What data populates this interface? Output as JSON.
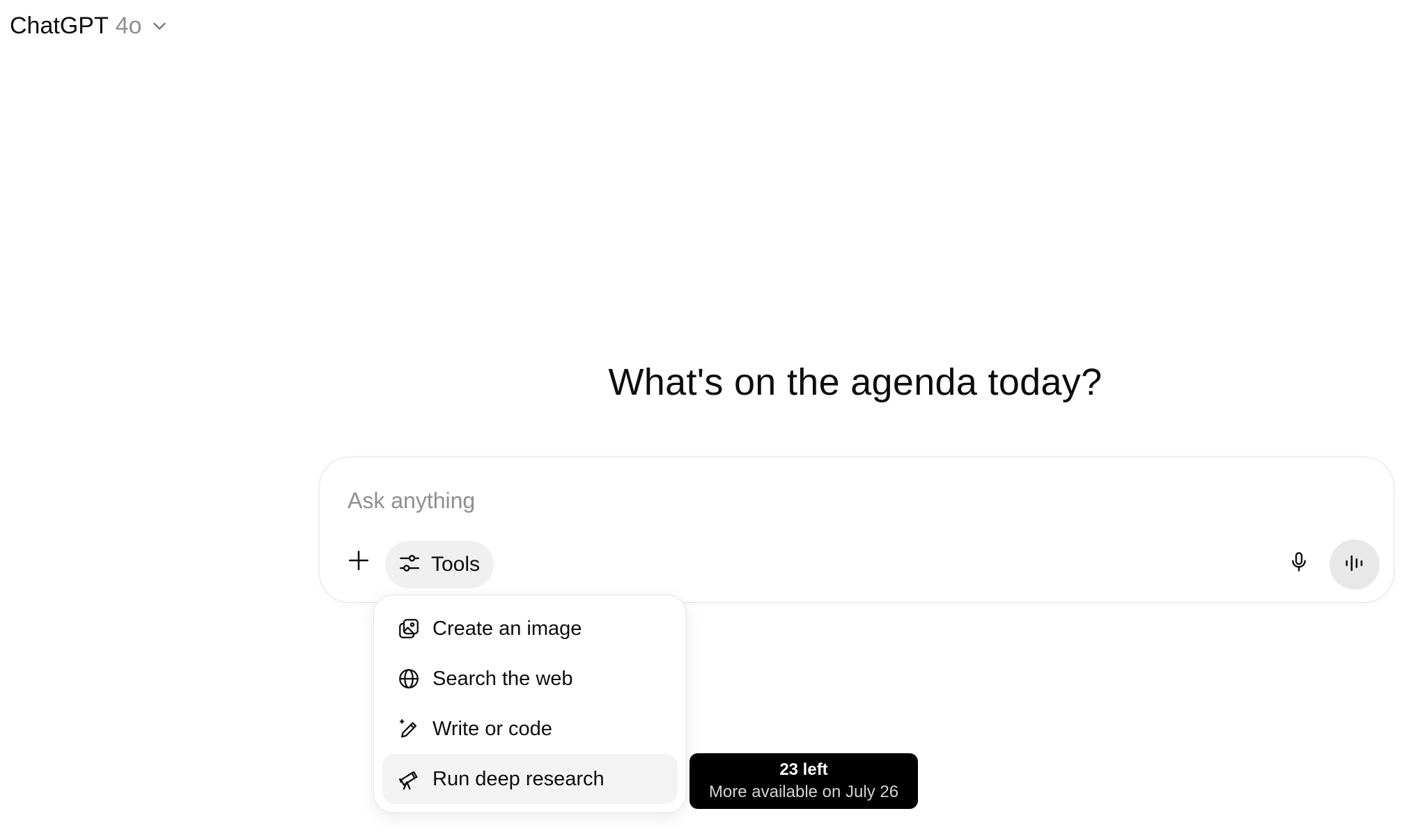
{
  "header": {
    "model_name": "ChatGPT",
    "model_version": "4o",
    "dropdown_icon": "chevron-down-icon"
  },
  "main": {
    "headline": "What's on the agenda today?"
  },
  "composer": {
    "placeholder": "Ask anything",
    "value": "",
    "add_icon": "plus-icon",
    "tools_label": "Tools",
    "tools_icon": "sliders-icon",
    "mic_icon": "microphone-icon",
    "voice_icon": "voice-waveform-icon"
  },
  "tools_menu": {
    "items": [
      {
        "label": "Create an image",
        "icon": "image-icon"
      },
      {
        "label": "Search the web",
        "icon": "globe-icon"
      },
      {
        "label": "Write or code",
        "icon": "pencil-sparkle-icon"
      },
      {
        "label": "Run deep research",
        "icon": "telescope-icon",
        "active": true
      }
    ]
  },
  "tooltip": {
    "title": "23 left",
    "subtitle": "More available on July 26"
  },
  "colors": {
    "text": "#0d0d0d",
    "muted": "#8f8f8f",
    "tools_bg": "#f0f0f0",
    "voice_bg": "#e8e8e8",
    "active_item_bg": "#f3f3f3",
    "tooltip_bg": "#000000"
  }
}
